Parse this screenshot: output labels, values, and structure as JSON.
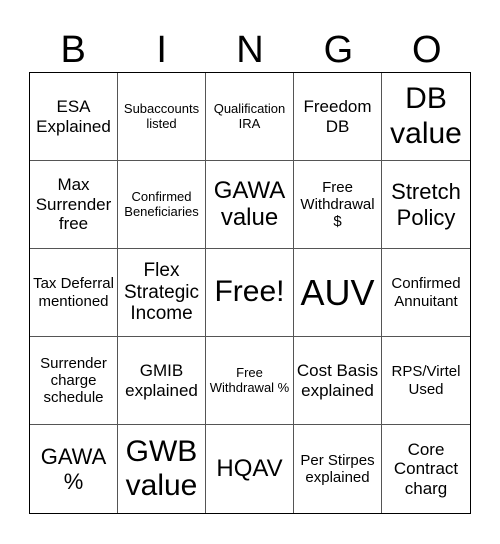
{
  "header": [
    "B",
    "I",
    "N",
    "G",
    "O"
  ],
  "cells": [
    "ESA Explained",
    "Subaccounts listed",
    "Qualification IRA",
    "Freedom DB",
    "DB value",
    "Max Surrender free",
    "Confirmed Beneficiaries",
    "GAWA value",
    "Free Withdrawal $",
    "Stretch Policy",
    "Tax Deferral mentioned",
    "Flex Strategic Income",
    "Free!",
    "AUV",
    "Confirmed Annuitant",
    "Surrender charge schedule",
    "GMIB explained",
    "Free Withdrawal %",
    "Cost Basis explained",
    "RPS/Virtel Used",
    "GAWA %",
    "GWB value",
    "HQAV",
    "Per Stirpes explained",
    "Core Contract charg"
  ]
}
